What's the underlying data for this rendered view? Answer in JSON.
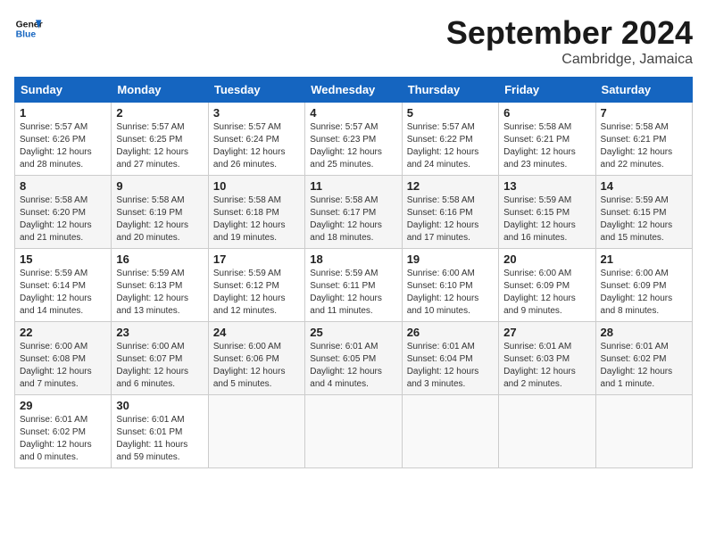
{
  "header": {
    "logo_line1": "General",
    "logo_line2": "Blue",
    "month": "September 2024",
    "location": "Cambridge, Jamaica"
  },
  "weekdays": [
    "Sunday",
    "Monday",
    "Tuesday",
    "Wednesday",
    "Thursday",
    "Friday",
    "Saturday"
  ],
  "weeks": [
    [
      {
        "num": "1",
        "sunrise": "5:57 AM",
        "sunset": "6:26 PM",
        "daylight": "12 hours and 28 minutes."
      },
      {
        "num": "2",
        "sunrise": "5:57 AM",
        "sunset": "6:25 PM",
        "daylight": "12 hours and 27 minutes."
      },
      {
        "num": "3",
        "sunrise": "5:57 AM",
        "sunset": "6:24 PM",
        "daylight": "12 hours and 26 minutes."
      },
      {
        "num": "4",
        "sunrise": "5:57 AM",
        "sunset": "6:23 PM",
        "daylight": "12 hours and 25 minutes."
      },
      {
        "num": "5",
        "sunrise": "5:57 AM",
        "sunset": "6:22 PM",
        "daylight": "12 hours and 24 minutes."
      },
      {
        "num": "6",
        "sunrise": "5:58 AM",
        "sunset": "6:21 PM",
        "daylight": "12 hours and 23 minutes."
      },
      {
        "num": "7",
        "sunrise": "5:58 AM",
        "sunset": "6:21 PM",
        "daylight": "12 hours and 22 minutes."
      }
    ],
    [
      {
        "num": "8",
        "sunrise": "5:58 AM",
        "sunset": "6:20 PM",
        "daylight": "12 hours and 21 minutes."
      },
      {
        "num": "9",
        "sunrise": "5:58 AM",
        "sunset": "6:19 PM",
        "daylight": "12 hours and 20 minutes."
      },
      {
        "num": "10",
        "sunrise": "5:58 AM",
        "sunset": "6:18 PM",
        "daylight": "12 hours and 19 minutes."
      },
      {
        "num": "11",
        "sunrise": "5:58 AM",
        "sunset": "6:17 PM",
        "daylight": "12 hours and 18 minutes."
      },
      {
        "num": "12",
        "sunrise": "5:58 AM",
        "sunset": "6:16 PM",
        "daylight": "12 hours and 17 minutes."
      },
      {
        "num": "13",
        "sunrise": "5:59 AM",
        "sunset": "6:15 PM",
        "daylight": "12 hours and 16 minutes."
      },
      {
        "num": "14",
        "sunrise": "5:59 AM",
        "sunset": "6:15 PM",
        "daylight": "12 hours and 15 minutes."
      }
    ],
    [
      {
        "num": "15",
        "sunrise": "5:59 AM",
        "sunset": "6:14 PM",
        "daylight": "12 hours and 14 minutes."
      },
      {
        "num": "16",
        "sunrise": "5:59 AM",
        "sunset": "6:13 PM",
        "daylight": "12 hours and 13 minutes."
      },
      {
        "num": "17",
        "sunrise": "5:59 AM",
        "sunset": "6:12 PM",
        "daylight": "12 hours and 12 minutes."
      },
      {
        "num": "18",
        "sunrise": "5:59 AM",
        "sunset": "6:11 PM",
        "daylight": "12 hours and 11 minutes."
      },
      {
        "num": "19",
        "sunrise": "6:00 AM",
        "sunset": "6:10 PM",
        "daylight": "12 hours and 10 minutes."
      },
      {
        "num": "20",
        "sunrise": "6:00 AM",
        "sunset": "6:09 PM",
        "daylight": "12 hours and 9 minutes."
      },
      {
        "num": "21",
        "sunrise": "6:00 AM",
        "sunset": "6:09 PM",
        "daylight": "12 hours and 8 minutes."
      }
    ],
    [
      {
        "num": "22",
        "sunrise": "6:00 AM",
        "sunset": "6:08 PM",
        "daylight": "12 hours and 7 minutes."
      },
      {
        "num": "23",
        "sunrise": "6:00 AM",
        "sunset": "6:07 PM",
        "daylight": "12 hours and 6 minutes."
      },
      {
        "num": "24",
        "sunrise": "6:00 AM",
        "sunset": "6:06 PM",
        "daylight": "12 hours and 5 minutes."
      },
      {
        "num": "25",
        "sunrise": "6:01 AM",
        "sunset": "6:05 PM",
        "daylight": "12 hours and 4 minutes."
      },
      {
        "num": "26",
        "sunrise": "6:01 AM",
        "sunset": "6:04 PM",
        "daylight": "12 hours and 3 minutes."
      },
      {
        "num": "27",
        "sunrise": "6:01 AM",
        "sunset": "6:03 PM",
        "daylight": "12 hours and 2 minutes."
      },
      {
        "num": "28",
        "sunrise": "6:01 AM",
        "sunset": "6:02 PM",
        "daylight": "12 hours and 1 minute."
      }
    ],
    [
      {
        "num": "29",
        "sunrise": "6:01 AM",
        "sunset": "6:02 PM",
        "daylight": "12 hours and 0 minutes."
      },
      {
        "num": "30",
        "sunrise": "6:01 AM",
        "sunset": "6:01 PM",
        "daylight": "11 hours and 59 minutes."
      },
      null,
      null,
      null,
      null,
      null
    ]
  ]
}
